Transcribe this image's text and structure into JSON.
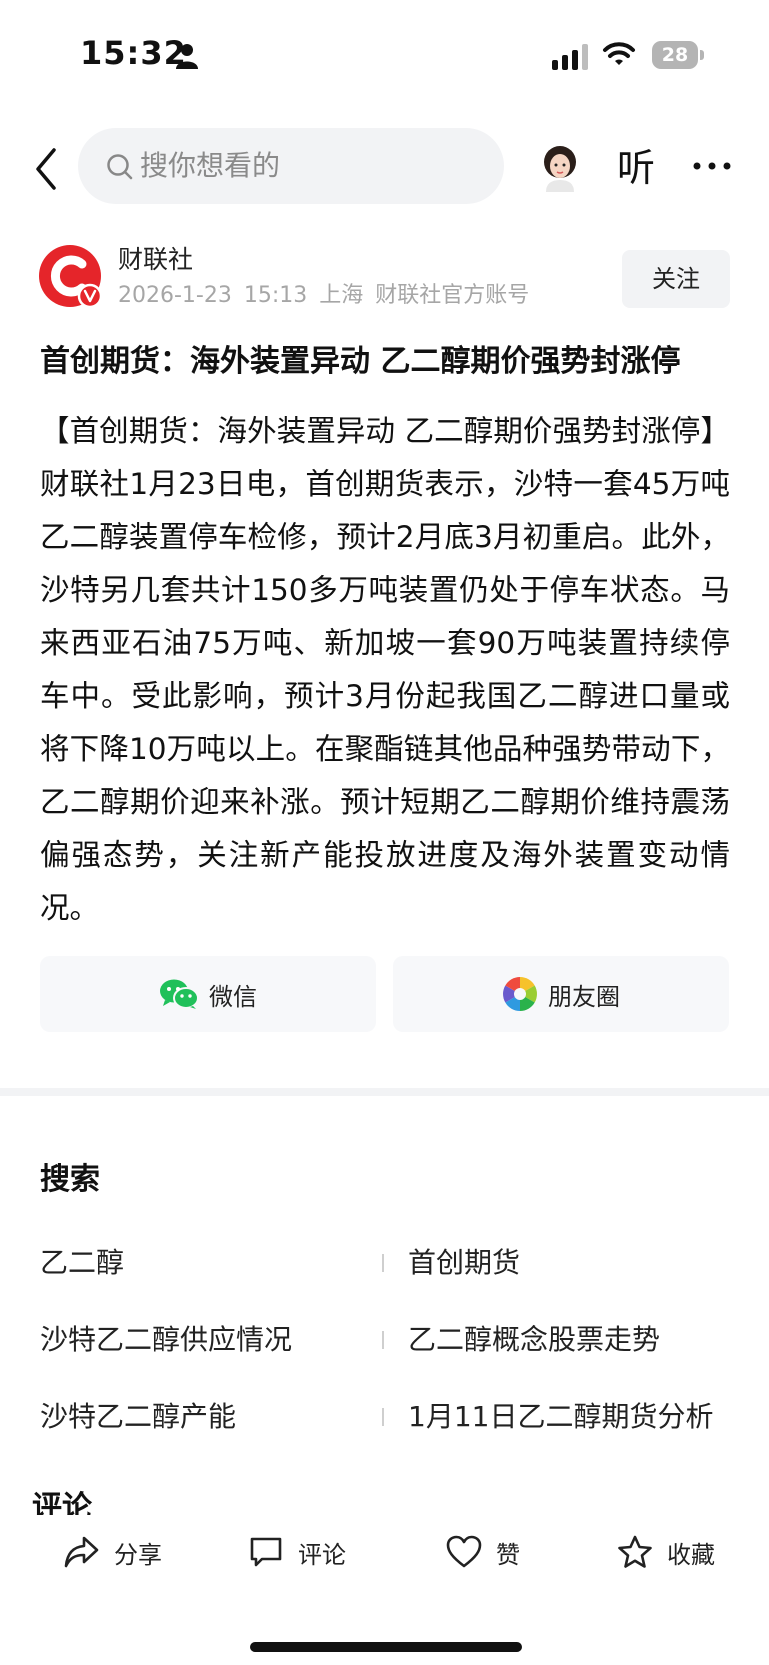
{
  "status_bar": {
    "time": "15:32",
    "battery": "28",
    "battery_level": 0.28
  },
  "nav": {
    "search_placeholder": "搜你想看的",
    "listen_label": "听"
  },
  "author": {
    "name": "财联社",
    "date": "2026-1-23",
    "time": "15:13",
    "location": "上海",
    "account_type": "财联社官方账号",
    "follow_label": "关注"
  },
  "article": {
    "title": "首创期货：海外装置异动 乙二醇期价强势封涨停",
    "body": "【首创期货：海外装置异动 乙二醇期价强势封涨停】财联社1月23日电，首创期货表示，沙特一套45万吨乙二醇装置停车检修，预计2月底3月初重启。此外，沙特另几套共计150多万吨装置仍处于停车状态。马来西亚石油75万吨、新加坡一套90万吨装置持续停车中。受此影响，预计3月份起我国乙二醇进口量或将下降10万吨以上。在聚酯链其他品种强势带动下，乙二醇期价迎来补涨。预计短期乙二醇期价维持震荡偏强态势，关注新产能投放进度及海外装置变动情况。"
  },
  "share": {
    "wechat_label": "微信",
    "moments_label": "朋友圈"
  },
  "search_section": {
    "title": "搜索",
    "keywords": [
      [
        "乙二醇",
        "首创期货"
      ],
      [
        "沙特乙二醇供应情况",
        "乙二醇概念股票走势"
      ],
      [
        "沙特乙二醇产能",
        "1月11日乙二醇期货分析"
      ]
    ]
  },
  "comments_title": "评论",
  "bottom_bar": {
    "share": "分享",
    "comment": "评论",
    "like": "赞",
    "favorite": "收藏"
  },
  "colors": {
    "brand_red": "#e5252a",
    "wechat_green": "#20c05a",
    "text": "#111111",
    "muted": "#a6a6a6"
  }
}
